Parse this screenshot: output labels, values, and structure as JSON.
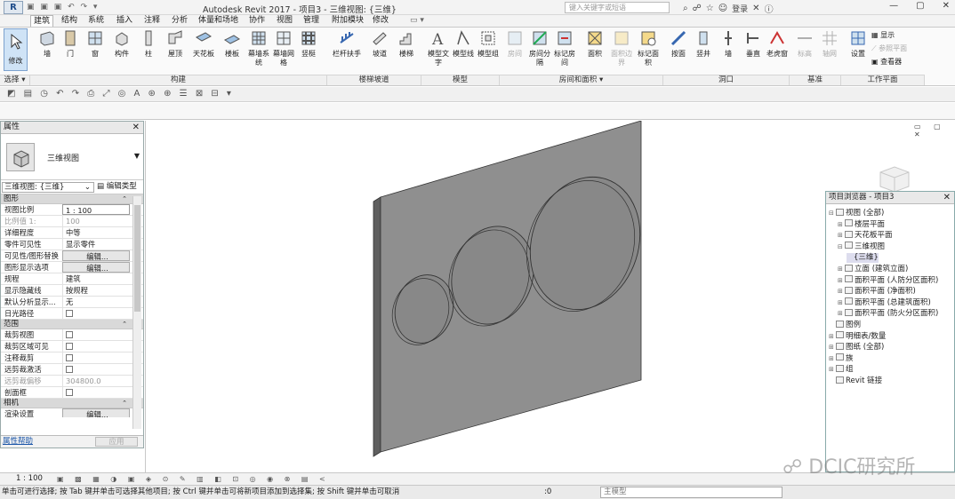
{
  "window": {
    "app_title": "Autodesk Revit 2017 -      项目3 - 三维视图: {三维}",
    "search_placeholder": "键入关键字或短语",
    "login_label": "登录"
  },
  "tabs": [
    "建筑",
    "结构",
    "系统",
    "插入",
    "注释",
    "分析",
    "体量和场地",
    "协作",
    "视图",
    "管理",
    "附加模块",
    "修改"
  ],
  "ribbon": {
    "modify": "修改",
    "build": [
      "墙",
      "门",
      "窗",
      "构件",
      "柱",
      "屋顶",
      "天花板",
      "楼板",
      "幕墙系统",
      "幕墙网格",
      "竖梃"
    ],
    "circulation": [
      "栏杆扶手",
      "坡道",
      "楼梯"
    ],
    "model": [
      "模型文字",
      "模型线",
      "模型组"
    ],
    "room": [
      "房间",
      "房间分隔",
      "标记房间",
      "面积",
      "面积边界",
      "标记面积"
    ],
    "opening": [
      "按面",
      "竖井",
      "墙",
      "垂直",
      "老虎窗"
    ],
    "datum": [
      "标高",
      "轴网"
    ],
    "workplane": [
      "设置",
      "显示",
      "参照平面",
      "查看器"
    ],
    "panels": [
      "选择 ▾",
      "构建",
      "楼梯坡道",
      "模型",
      "房间和面积 ▾",
      "洞口",
      "基准",
      "工作平面"
    ]
  },
  "properties": {
    "title": "属性",
    "type_name": "三维视图",
    "instance_select": "三维视图: {三维}",
    "edit_type": "编辑类型",
    "sections": {
      "graphics": "图形",
      "extents": "范围",
      "camera": "相机"
    },
    "graphics_rows": [
      {
        "k": "视图比例",
        "v": "1 : 100"
      },
      {
        "k": "比例值 1:",
        "v": "100"
      },
      {
        "k": "详细程度",
        "v": "中等"
      },
      {
        "k": "零件可见性",
        "v": "显示零件"
      },
      {
        "k": "可见性/图形替换",
        "v": "编辑..."
      },
      {
        "k": "图形显示选项",
        "v": "编辑..."
      },
      {
        "k": "规程",
        "v": "建筑"
      },
      {
        "k": "显示隐藏线",
        "v": "按规程"
      },
      {
        "k": "默认分析显示...",
        "v": "无"
      },
      {
        "k": "日光路径",
        "v": ""
      }
    ],
    "extents_rows": [
      {
        "k": "裁剪视图",
        "v": ""
      },
      {
        "k": "裁剪区域可见",
        "v": ""
      },
      {
        "k": "注释裁剪",
        "v": ""
      },
      {
        "k": "远剪裁激活",
        "v": ""
      },
      {
        "k": "远剪裁偏移",
        "v": "304800.0"
      },
      {
        "k": "剖面框",
        "v": ""
      }
    ],
    "camera_rows": [
      {
        "k": "渲染设置",
        "v": "编辑..."
      }
    ],
    "help": "属性帮助",
    "apply": "应用"
  },
  "browser": {
    "title": "项目浏览器 - 项目3",
    "nodes": [
      {
        "label": "视图 (全部)",
        "lvl": 0,
        "tw": "⊟"
      },
      {
        "label": "楼层平面",
        "lvl": 1,
        "tw": "⊞"
      },
      {
        "label": "天花板平面",
        "lvl": 1,
        "tw": "⊞"
      },
      {
        "label": "三维视图",
        "lvl": 1,
        "tw": "⊟"
      },
      {
        "label": "{三维}",
        "lvl": 2,
        "tw": ""
      },
      {
        "label": "立面 (建筑立面)",
        "lvl": 1,
        "tw": "⊞"
      },
      {
        "label": "面积平面 (人防分区面积)",
        "lvl": 1,
        "tw": "⊞"
      },
      {
        "label": "面积平面 (净面积)",
        "lvl": 1,
        "tw": "⊞"
      },
      {
        "label": "面积平面 (总建筑面积)",
        "lvl": 1,
        "tw": "⊞"
      },
      {
        "label": "面积平面 (防火分区面积)",
        "lvl": 1,
        "tw": "⊞"
      },
      {
        "label": "图例",
        "lvl": 0,
        "tw": ""
      },
      {
        "label": "明细表/数量",
        "lvl": 0,
        "tw": "⊞"
      },
      {
        "label": "图纸 (全部)",
        "lvl": 0,
        "tw": "⊞"
      },
      {
        "label": "族",
        "lvl": 0,
        "tw": "⊞"
      },
      {
        "label": "组",
        "lvl": 0,
        "tw": "⊞"
      },
      {
        "label": "Revit 链接",
        "lvl": 0,
        "tw": ""
      }
    ]
  },
  "viewbar": {
    "scale": "1 : 100"
  },
  "status": {
    "text": "单击可进行选择; 按 Tab 键并单击可选择其他项目; 按 Ctrl 键并单击可将新项目添加到选择集; 按 Shift 键并单击可取消",
    "zero": ":0",
    "main_model": "主模型"
  },
  "watermark": "DCIC研究所",
  "colors": {
    "accent": "#cfe3f6",
    "panel_face": "#8f8f8f",
    "panel_side": "#5f5f5f"
  }
}
